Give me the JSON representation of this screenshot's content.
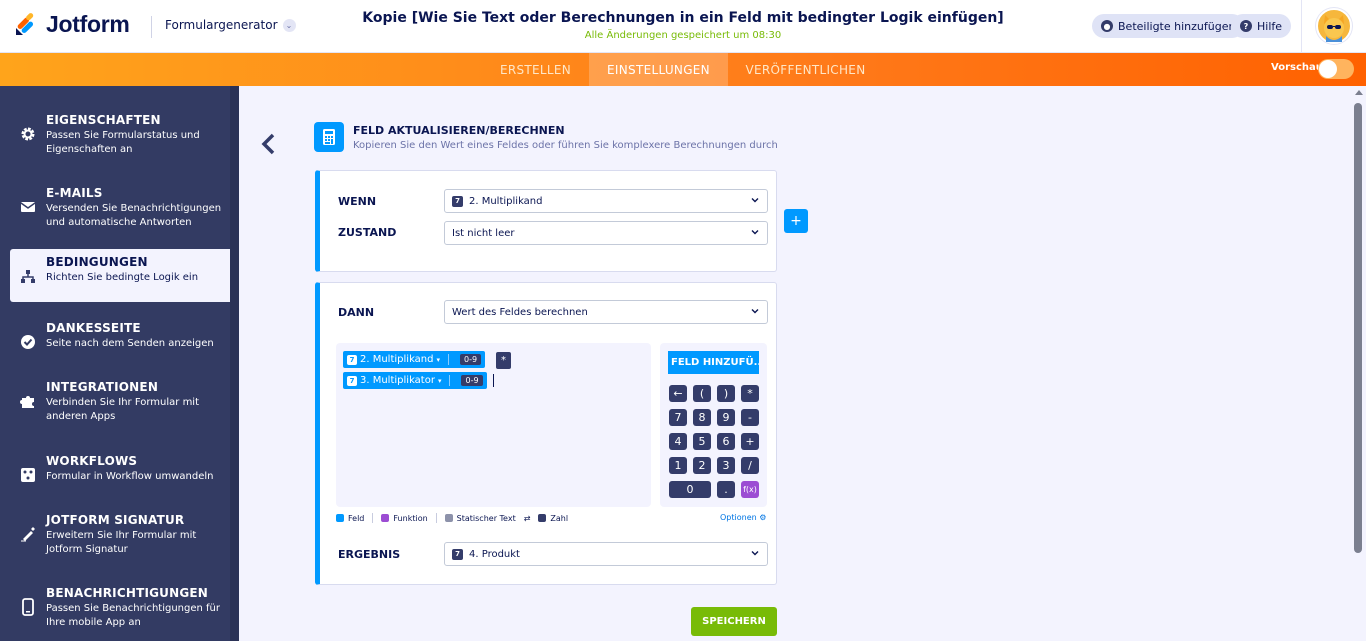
{
  "header": {
    "logo_text": "Jotform",
    "builder_label": "Formulargenerator",
    "form_title": "Kopie [Wie Sie Text oder Berechnungen in ein Feld mit bedingter Logik einfügen]",
    "saved_status": "Alle Änderungen gespeichert um 08:30",
    "add_participants": "Beteiligte hinzufügen",
    "help": "Hilfe"
  },
  "tabs": [
    {
      "label": "ERSTELLEN",
      "active": false
    },
    {
      "label": "EINSTELLUNGEN",
      "active": true
    },
    {
      "label": "VERÖFFENTLICHEN",
      "active": false
    }
  ],
  "preview_label": "Vorschau",
  "sidebar": {
    "items": [
      {
        "title": "EIGENSCHAFTEN",
        "desc": "Passen Sie Formularstatus und Eigenschaften an",
        "icon": "gear-icon"
      },
      {
        "title": "E-MAILS",
        "desc": "Versenden Sie Benachrichtigungen und automatische Antworten",
        "icon": "envelope-icon"
      },
      {
        "title": "BEDINGUNGEN",
        "desc": "Richten Sie bedingte Logik ein",
        "icon": "sitemap-icon",
        "active": true
      },
      {
        "title": "DANKESSEITE",
        "desc": "Seite nach dem Senden anzeigen",
        "icon": "check-circle-icon"
      },
      {
        "title": "INTEGRATIONEN",
        "desc": "Verbinden Sie Ihr Formular mit anderen Apps",
        "icon": "puzzle-icon"
      },
      {
        "title": "WORKFLOWS",
        "desc": "Formular in Workflow umwandeln",
        "icon": "workflow-icon"
      },
      {
        "title": "JOTFORM SIGNATUR",
        "desc": "Erweitern Sie Ihr Formular mit Jotform Signatur",
        "icon": "signature-icon"
      },
      {
        "title": "BENACHRICHTIGUNGEN",
        "desc": "Passen Sie Benachrichtigungen für Ihre mobile App an",
        "icon": "mobile-icon"
      }
    ]
  },
  "rule": {
    "heading": "FELD AKTUALISIEREN/BERECHNEN",
    "subheading": "Kopieren Sie den Wert eines Feldes oder führen Sie komplexere Berechnungen durch",
    "if_label": "WENN",
    "if_field_num": "7",
    "if_field": "2. Multiplikand",
    "state_label": "ZUSTAND",
    "state_value": "Ist nicht leer",
    "add_button": "+",
    "then_label": "DANN",
    "then_value": "Wert des Feldes berechnen",
    "formula": {
      "chip1_num": "7",
      "chip1_label": "2. Multiplikand",
      "chip1_range": "0-9",
      "operator": "*",
      "chip2_num": "7",
      "chip2_label": "3. Multiplikator",
      "chip2_range": "0-9"
    },
    "add_field_button": "FELD HINZUFÜ...",
    "keys": [
      "←",
      "(",
      ")",
      "*",
      "7",
      "8",
      "9",
      "-",
      "4",
      "5",
      "6",
      "+",
      "1",
      "2",
      "3",
      "/",
      "0",
      ".",
      "f(x)"
    ],
    "legend": {
      "field": "Feld",
      "function": "Funktion",
      "static": "Statischer Text",
      "number": "Zahl"
    },
    "options": "Optionen",
    "result_label": "ERGEBNIS",
    "result_num": "7",
    "result_value": "4. Produkt",
    "save_button": "SPEICHERN"
  },
  "colors": {
    "accent": "#0099ff",
    "orange": "#ff7a1a",
    "sidebar": "#333b63",
    "save": "#78bb07",
    "function": "#9c4dd3"
  }
}
